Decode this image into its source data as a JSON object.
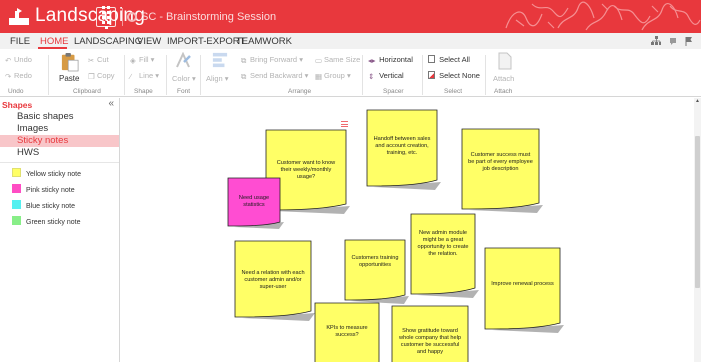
{
  "app": {
    "name": "Landscaping",
    "document_title": "SC - Brainstorming Session"
  },
  "menu": {
    "items": [
      "FILE",
      "HOME",
      "LANDSCAPING",
      "VIEW",
      "IMPORT-EXPORT",
      "TEAMWORK"
    ],
    "active": "HOME"
  },
  "ribbon": {
    "undo": "Undo",
    "redo": "Redo",
    "paste": "Paste",
    "cut": "Cut",
    "copy": "Copy",
    "fill": "Fill",
    "line": "Line",
    "color": "Color",
    "align": "Align",
    "bring_forward": "Bring Forward",
    "send_backward": "Send Backward",
    "same_size": "Same Size",
    "group": "Group",
    "horizontal": "Horizontal",
    "vertical": "Vertical",
    "select_all": "Select All",
    "select_none": "Select None",
    "attach": "Attach",
    "groups": {
      "undo": "Undo",
      "clipboard": "Clipboard",
      "shape": "Shape",
      "font": "Font",
      "arrange": "Arrange",
      "spacer": "Spacer",
      "select": "Select",
      "attach": "Attach"
    }
  },
  "shapes_panel": {
    "title": "Shapes",
    "collapse_glyph": "«",
    "categories": [
      "Basic shapes",
      "Images",
      "Sticky notes",
      "HWS"
    ],
    "selected_category": "Sticky notes",
    "notes": [
      {
        "label": "Yellow sticky note",
        "color": "#ffff66"
      },
      {
        "label": "Pink sticky note",
        "color": "#ff4dc4"
      },
      {
        "label": "Blue sticky note",
        "color": "#55f0f0"
      },
      {
        "label": "Green sticky note",
        "color": "#88ee88"
      }
    ]
  },
  "colors": {
    "brand": "#e8383d",
    "sticky_yellow": "#ffff66",
    "sticky_pink": "#ff4dd2"
  },
  "canvas": {
    "sticky_notes": [
      {
        "text": "Customer want to know their weekly/monthly usage?",
        "color": "yellow"
      },
      {
        "text": "Need usage statistics",
        "color": "pink"
      },
      {
        "text": "Handoff between sales and account creation, training, etc.",
        "color": "yellow"
      },
      {
        "text": "Customer success must be part of every employee job description",
        "color": "yellow"
      },
      {
        "text": "New admin module might be a great opportunity to create the relation.",
        "color": "yellow"
      },
      {
        "text": "Customers training opportunities",
        "color": "yellow"
      },
      {
        "text": "Need a relation with each customer admin and/or super-user",
        "color": "yellow"
      },
      {
        "text": "Improve renewal process",
        "color": "yellow"
      },
      {
        "text": "KPIs to measure success?",
        "color": "yellow"
      },
      {
        "text": "Show gratitude toward whole company that help customer be successful and happy",
        "color": "yellow"
      }
    ]
  }
}
